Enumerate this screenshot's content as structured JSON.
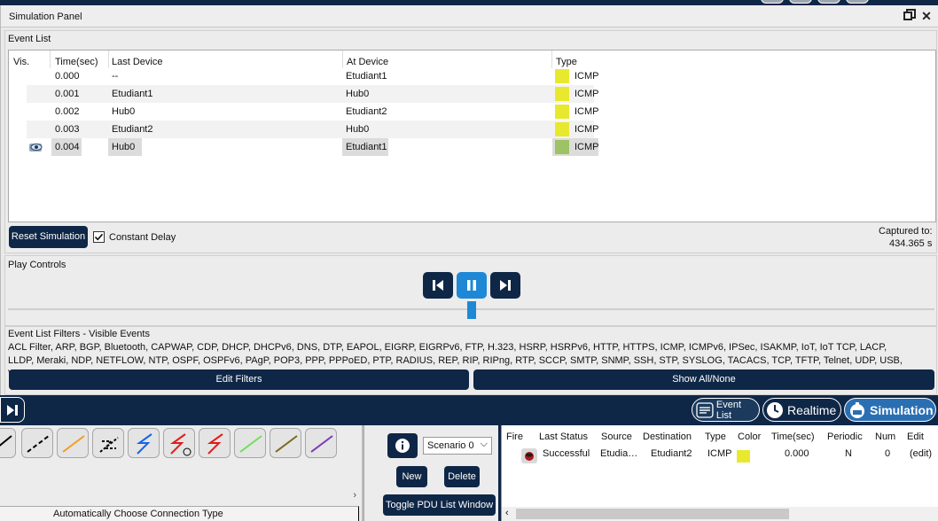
{
  "panel": {
    "title": "Simulation Panel",
    "event_list_title": "Event List",
    "columns": [
      "Vis.",
      "Time(sec)",
      "Last Device",
      "At Device",
      "Type"
    ],
    "events": [
      {
        "time": "0.000",
        "last": "--",
        "at": "Etudiant1",
        "type": "ICMP",
        "color": "#e8e82e",
        "visible": false
      },
      {
        "time": "0.001",
        "last": "Etudiant1",
        "at": "Hub0",
        "type": "ICMP",
        "color": "#e8e82e",
        "visible": false
      },
      {
        "time": "0.002",
        "last": "Hub0",
        "at": "Etudiant2",
        "type": "ICMP",
        "color": "#e8e82e",
        "visible": false
      },
      {
        "time": "0.003",
        "last": "Etudiant2",
        "at": "Hub0",
        "type": "ICMP",
        "color": "#e8e82e",
        "visible": false
      },
      {
        "time": "0.004",
        "last": "Hub0",
        "at": "Etudiant1",
        "type": "ICMP",
        "color": "#9ec266",
        "visible": true
      }
    ],
    "reset_label": "Reset Simulation",
    "constant_delay_label": "Constant Delay",
    "constant_delay_checked": true,
    "captured_label": "Captured to:",
    "captured_value": "434.365 s",
    "play_controls_title": "Play Controls",
    "playback_state": "playing",
    "filters_title": "Event List Filters - Visible Events",
    "filters_text": "ACL Filter, ARP, BGP, Bluetooth, CAPWAP, CDP, DHCP, DHCPv6, DNS, DTP, EAPOL, EIGRP, EIGRPv6, FTP, H.323, HSRP, HSRPv6, HTTP, HTTPS, ICMP, ICMPv6, IPSec, ISAKMP, IoT, IoT TCP, LACP, LLDP, Meraki, NDP, NETFLOW, NTP, OSPF, OSPFv6, PAgP, POP3, PPP, PPPoED, PTP, RADIUS, REP, RIP, RIPng, RTP, SCCP, SMTP, SNMP, SSH, STP, SYSLOG, TACACS, TCP, TFTP, Telnet, UDP, USB, VTP",
    "edit_filters_label": "Edit Filters",
    "show_all_label": "Show All/None"
  },
  "modes": {
    "event_list_label": "Event List",
    "realtime_label": "Realtime",
    "simulation_label": "Simulation"
  },
  "scenario": {
    "selected": "Scenario 0",
    "new_label": "New",
    "delete_label": "Delete",
    "toggle_label": "Toggle PDU List Window"
  },
  "connection_hint": "Automatically Choose Connection Type",
  "pdu": {
    "columns": [
      "Fire",
      "Last Status",
      "Source",
      "Destination",
      "Type",
      "Color",
      "Time(sec)",
      "Periodic",
      "Num",
      "Edit"
    ],
    "rows": [
      {
        "status": "Successful",
        "source": "Etudia…",
        "destination": "Etudiant2",
        "type": "ICMP",
        "color": "#e8e82e",
        "time": "0.000",
        "periodic": "N",
        "num": "0",
        "edit": "(edit)"
      }
    ]
  }
}
